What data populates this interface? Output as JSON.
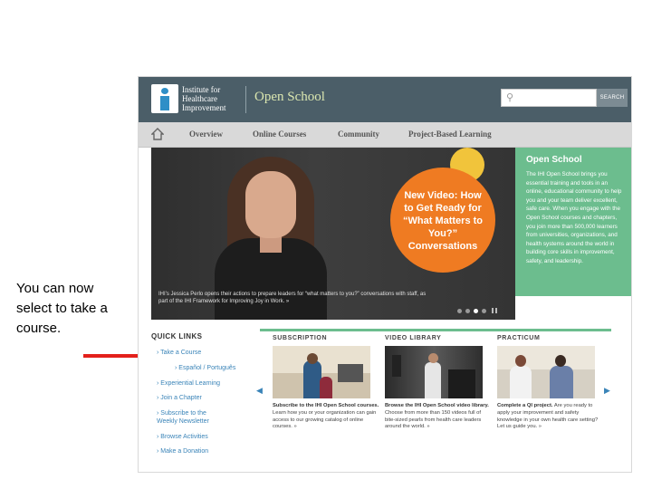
{
  "caption": "You can now select to take a course.",
  "colors": {
    "header": "#4b5e68",
    "brand_title": "#dbe7b0",
    "accent_green": "#6cbd8e",
    "video_orange": "#ef7b22",
    "video_yellow": "#f1c43b",
    "arrow_red": "#e3201b",
    "link_blue": "#3a84b8"
  },
  "header": {
    "logo_text": "Institute for Healthcare Improvement",
    "title": "Open School",
    "search_placeholder": "",
    "search_button": "SEARCH",
    "icons": [
      "ihi-logo-icon",
      "search-icon"
    ]
  },
  "nav": {
    "home_icon": "home-icon",
    "items": [
      "Overview",
      "Online Courses",
      "Community",
      "Project-Based Learning"
    ]
  },
  "hero": {
    "video_title": "New Video: How to Get Ready for “What Matters to You?” Conversations",
    "caption": "IHI’s Jessica Perlo opens their actions to prepare leaders for “what matters to you?” conversations with staff, as part of the IHI Framework for Improving Joy in Work. »",
    "slide_count": 4,
    "active_slide": 3
  },
  "open_school_box": {
    "title": "Open School",
    "body": "The IHI Open School brings you essential training and tools in an online, educational community to help you and your team deliver excellent, safe care. When you engage with the Open School courses and chapters, you join more than 500,000 learners from universities, organizations, and health systems around the world in building core skills in improvement, safety, and leadership."
  },
  "quick_links": {
    "heading": "QUICK LINKS",
    "items": [
      "Take a Course",
      "Español / Português",
      "Experiential Learning",
      "Join a Chapter",
      "Subscribe to the Weekly Newsletter",
      "Browse Activities",
      "Make a Donation"
    ]
  },
  "cards": [
    {
      "label": "SUBSCRIPTION",
      "lead": "Subscribe to the IHI Open School courses.",
      "text": "Learn how you or your organization can gain access to our growing catalog of online courses. »"
    },
    {
      "label": "VIDEO LIBRARY",
      "lead": "Browse the IHI Open School video library.",
      "text": "Choose from more than 150 videos full of bite-sized pearls from health care leaders around the world. »"
    },
    {
      "label": "PRACTICUM",
      "lead": "Complete a QI project.",
      "text": "Are you ready to apply your improvement and safety knowledge in your own health care setting? Let us guide you. »"
    }
  ]
}
